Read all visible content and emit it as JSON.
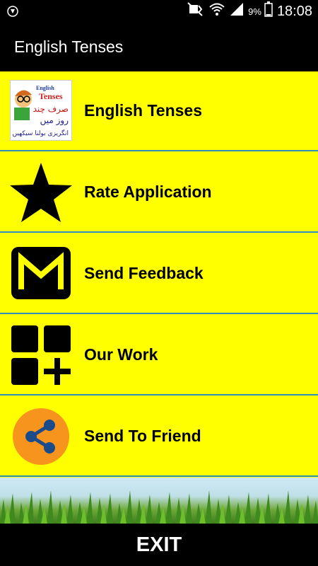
{
  "status_bar": {
    "battery_percent": "9%",
    "time": "18:08",
    "icons": [
      "shield-icon",
      "mute-icon",
      "wifi-icon",
      "signal-icon",
      "battery-icon"
    ]
  },
  "app_bar": {
    "title": "English Tenses"
  },
  "menu": {
    "items": [
      {
        "label": "English Tenses",
        "icon": "app-logo-icon"
      },
      {
        "label": "Rate Application",
        "icon": "star-icon"
      },
      {
        "label": "Send Feedback",
        "icon": "mail-icon"
      },
      {
        "label": "Our Work",
        "icon": "apps-grid-icon"
      },
      {
        "label": "Send To Friend",
        "icon": "share-icon"
      }
    ]
  },
  "logo": {
    "title": "English",
    "subtitle": "Tenses",
    "urdu_line1": "صرف چند",
    "urdu_line2": "روز میں",
    "urdu_line3": "انگریزی بولنا سیکھیں"
  },
  "footer": {
    "exit_label": "EXIT"
  },
  "colors": {
    "menu_background": "#ffff00",
    "divider": "#2e8fb8",
    "share_circle": "#f7941d",
    "share_node": "#1c4b8c"
  }
}
